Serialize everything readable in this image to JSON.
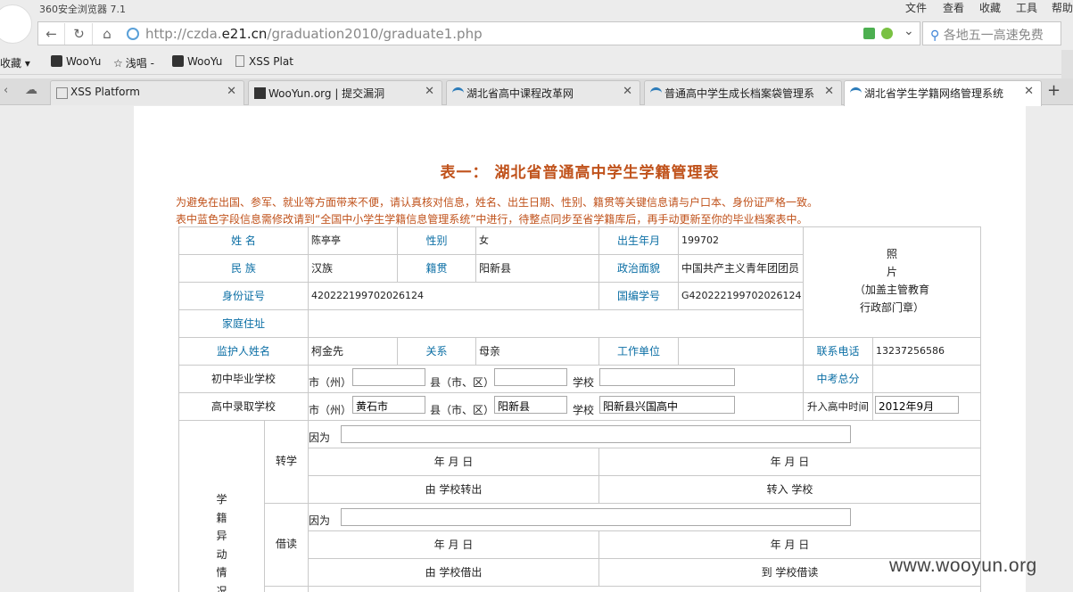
{
  "browser": {
    "title": "360安全浏览器 7.1",
    "menu": [
      "文件",
      "查看",
      "收藏",
      "工具",
      "帮助"
    ],
    "url_prefix": "http://czda.",
    "url_domain": "e21.cn",
    "url_path": "/graduation2010/graduate1.php",
    "search": "各地五一高速免费"
  },
  "bookmarks": [
    "收藏",
    "WooYu",
    "浅唱 -",
    "WooYu",
    "XSS Plat"
  ],
  "tabs": [
    {
      "label": "XSS Platform"
    },
    {
      "label": "WooYun.org | 提交漏洞"
    },
    {
      "label": "湖北省高中课程改革网"
    },
    {
      "label": "普通高中学生成长档案袋管理系统"
    },
    {
      "label": "湖北省学生学籍网络管理系统"
    }
  ],
  "form": {
    "title": "表一：  湖北省普通高中学生学籍管理表",
    "notice1": "为避免在出国、参军、就业等方面带来不便，请认真核对信息，姓名、出生日期、性别、籍贯等关键信息请与户口本、身份证严格一致。",
    "notice2": "表中蓝色字段信息需修改请到“全国中小学生学籍信息管理系统”中进行，待整点同步至省学籍库后，再手动更新至你的毕业档案表中。",
    "labels": {
      "name": "姓 名",
      "gender": "性别",
      "birth": "出生年月",
      "ethnic": "民 族",
      "native": "籍贯",
      "political": "政治面貌",
      "idcard": "身份证号",
      "nationalid": "国编学号",
      "address": "家庭住址",
      "guardian": "监护人姓名",
      "relation": "关系",
      "workplace": "工作单位",
      "phone": "联系电话",
      "junior": "初中毕业学校",
      "zhongkao": "中考总分",
      "senior": "高中录取学校",
      "enroll": "升入高中时间",
      "change": "学\n籍\n异\n动\n情\n况",
      "transfer": "转学",
      "borrow": "借读"
    },
    "values": {
      "name": "陈亭亭",
      "gender": "女",
      "birth": "199702",
      "ethnic": "汉族",
      "native": "阳新县",
      "political": "中国共产主义青年团团员",
      "idcard": "420222199702026124",
      "nationalid": "G420222199702026124",
      "guardian": "柯金先",
      "relation": "母亲",
      "phone": "13237256586",
      "senior_city": "黄石市",
      "senior_county": "阳新县",
      "senior_school": "阳新县兴国高中",
      "enroll_time": "2012年9月"
    },
    "photo": [
      "照",
      "片",
      "（加盖主管教育",
      "行政部门章）"
    ],
    "units": {
      "city": "市（州）",
      "county": "县（市、区）",
      "school": "学校"
    },
    "reason": "因为",
    "date": "年   月   日",
    "transfer_out": "由   学校转出",
    "transfer_in": "转入   学校",
    "borrow_out": "由   学校借出",
    "borrow_in": "到   学校借读"
  },
  "watermark": "www.wooyun.org"
}
